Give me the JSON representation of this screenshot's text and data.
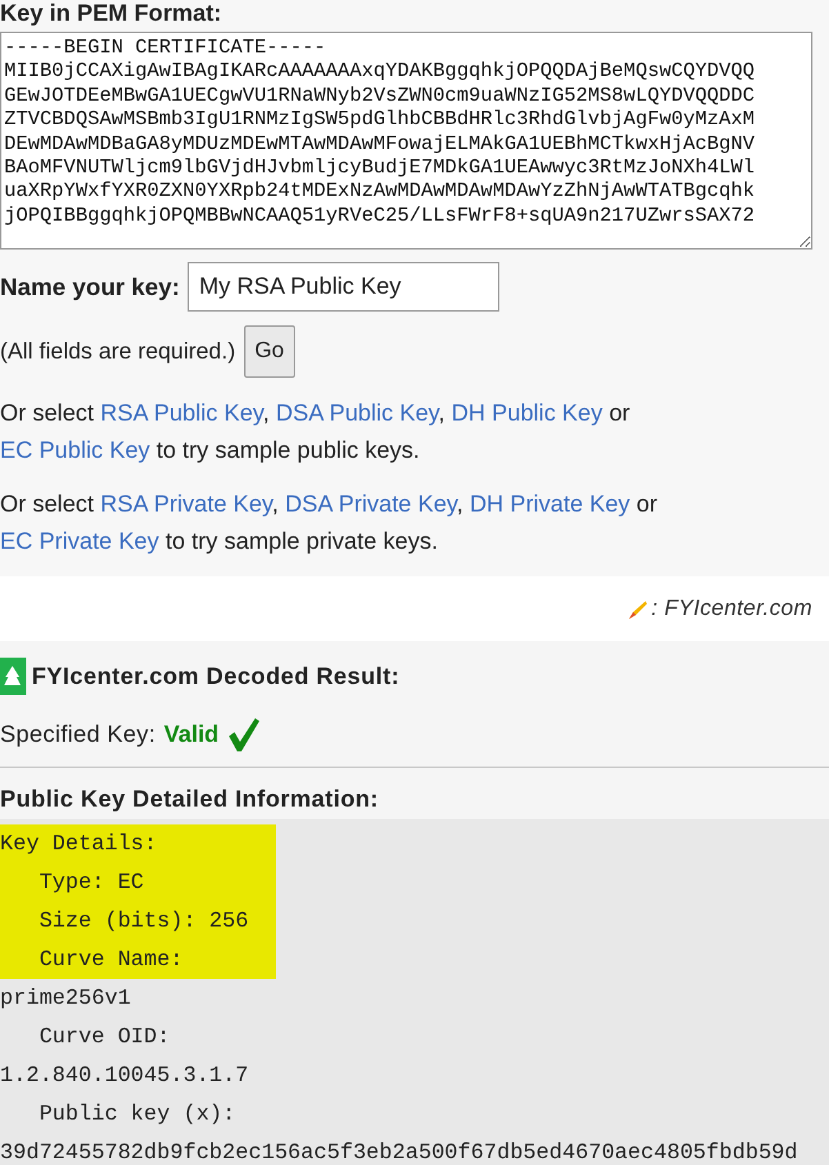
{
  "pem_section": {
    "label": "Key in PEM Format:",
    "value": "-----BEGIN CERTIFICATE-----\nMIIB0jCCAXigAwIBAgIKARcAAAAAAAxqYDAKBggqhkjOPQQDAjBeMQswCQYDVQQ\nGEwJOTDEeMBwGA1UECgwVU1RNaWNyb2VsZWN0cm9uaWNzIG52MS8wLQYDVQQDDC\nZTVCBDQSAwMSBmb3IgU1RNMzIgSW5pdGlhbCBBdHRlc3RhdGlvbjAgFw0yMzAxM\nDEwMDAwMDBaGA8yMDUzMDEwMTAwMDAwMFowajELMAkGA1UEBhMCTkwxHjAcBgNV\nBAoMFVNUTWljcm9lbGVjdHJvbmljcyBudjE7MDkGA1UEAwwyc3RtMzJoNXh4LWl\nuaXRpYWxfYXR0ZXN0YXRpb24tMDExNzAwMDAwMDAwMDAwYzZhNjAwWTATBgcqhk\njOPQIBBggqhkjOPQMBBwNCAAQ51yRVeC25/LLsFWrF8+sqUA9n217UZwrsSAX72"
  },
  "name_field": {
    "label": "Name your key:",
    "value": "My RSA Public Key"
  },
  "required_note": "(All fields are required.)",
  "go_button": "Go",
  "sample_lines": [
    {
      "parts": [
        {
          "text": "Or select ",
          "link": false
        },
        {
          "text": "RSA Public Key",
          "link": true
        },
        {
          "text": ", ",
          "link": false
        },
        {
          "text": "DSA Public Key",
          "link": true
        },
        {
          "text": ", ",
          "link": false
        },
        {
          "text": "DH Public Key",
          "link": true
        },
        {
          "text": " or ",
          "link": false
        },
        {
          "text": "EC Public Key",
          "link": true
        },
        {
          "text": " to try sample public keys.",
          "link": false
        }
      ]
    },
    {
      "parts": [
        {
          "text": "Or select ",
          "link": false
        },
        {
          "text": "RSA Private Key",
          "link": true
        },
        {
          "text": ", ",
          "link": false
        },
        {
          "text": "DSA Private Key",
          "link": true
        },
        {
          "text": ", ",
          "link": false
        },
        {
          "text": "DH Private Key",
          "link": true
        },
        {
          "text": " or ",
          "link": false
        },
        {
          "text": "EC Private Key",
          "link": true
        },
        {
          "text": " to try sample private keys.",
          "link": false
        }
      ]
    }
  ],
  "credit": ": FYIcenter.com",
  "result": {
    "title": "FYIcenter.com Decoded Result:",
    "status_label": "Specified Key:",
    "status": "Valid",
    "valid": true
  },
  "details": {
    "title": "Public Key Detailed Information:",
    "lines": [
      {
        "text": "Key Details:",
        "highlighted": true
      },
      {
        "text": "   Type: EC",
        "highlighted": true
      },
      {
        "text": "   Size (bits): 256",
        "highlighted": true
      },
      {
        "text": "   Curve Name:",
        "highlighted": true
      },
      {
        "text": "prime256v1",
        "highlighted": false
      },
      {
        "text": "   Curve OID:",
        "highlighted": false
      },
      {
        "text": "1.2.840.10045.3.1.7",
        "highlighted": false
      },
      {
        "text": "   Public key (x):",
        "highlighted": false
      },
      {
        "text": "39d72455782db9fcb2ec156ac5f3eb2a500f67db5ed4670aec4805fbdb59d",
        "highlighted": false
      }
    ]
  }
}
